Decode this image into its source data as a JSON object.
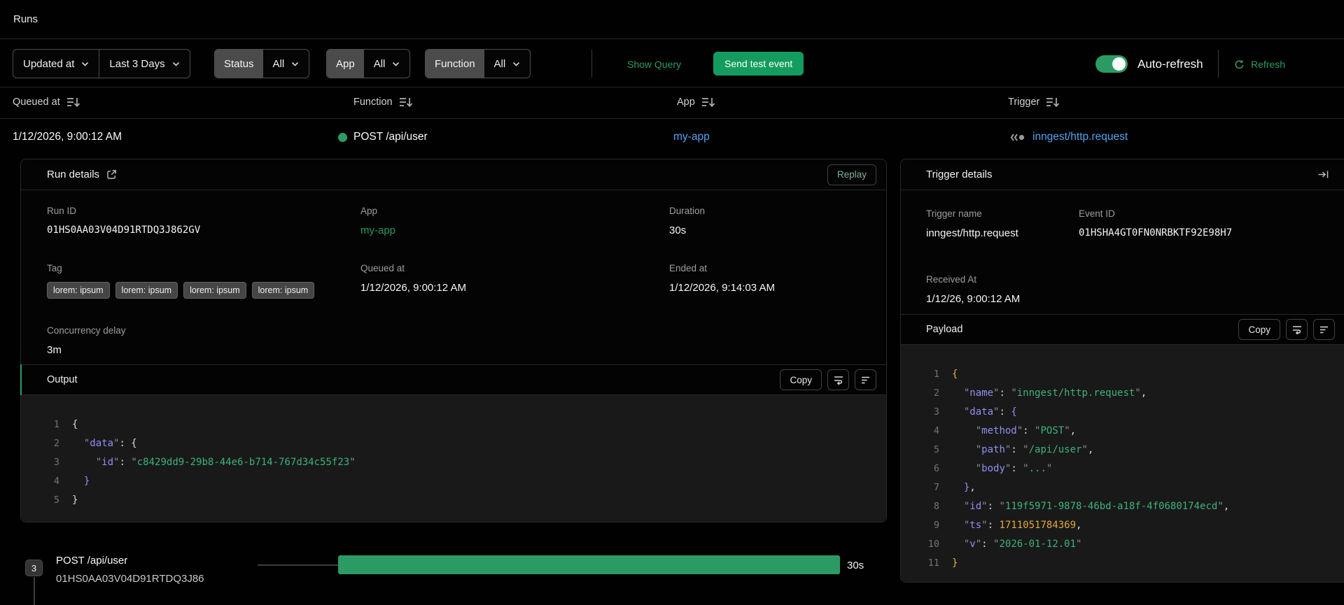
{
  "page": {
    "title": "Runs"
  },
  "filters": {
    "sort_field": "Updated at",
    "time_range": "Last 3 Days",
    "status": {
      "label": "Status",
      "value": "All"
    },
    "app": {
      "label": "App",
      "value": "All"
    },
    "function": {
      "label": "Function",
      "value": "All"
    },
    "show_query": "Show Query",
    "send_test_event": "Send test event",
    "auto_refresh_label": "Auto-refresh",
    "auto_refresh_on": true,
    "refresh_label": "Refresh"
  },
  "table": {
    "columns": {
      "queued_at": "Queued at",
      "function": "Function",
      "app": "App",
      "trigger": "Trigger"
    },
    "row": {
      "queued_at": "1/12/2026, 9:00:12 AM",
      "function": "POST /api/user",
      "status_color": "#2c9b63",
      "app": "my-app",
      "trigger": "inngest/http.request"
    }
  },
  "run_details": {
    "title": "Run details",
    "replay_label": "Replay",
    "run_id": {
      "label": "Run ID",
      "value": "01HS0AA03V04D91RTDQ3J862GV"
    },
    "app": {
      "label": "App",
      "value": "my-app"
    },
    "duration": {
      "label": "Duration",
      "value": "30s"
    },
    "tag": {
      "label": "Tag",
      "chips": [
        "lorem: ipsum",
        "lorem: ipsum",
        "lorem: ipsum",
        "lorem: ipsum"
      ]
    },
    "queued_at": {
      "label": "Queued at",
      "value": "1/12/2026, 9:00:12 AM"
    },
    "ended_at": {
      "label": "Ended at",
      "value": "1/12/2026, 9:14:03 AM"
    },
    "concurrency_delay": {
      "label": "Concurrency delay",
      "value": "3m"
    },
    "output": {
      "title": "Output",
      "copy_label": "Copy",
      "lines": [
        [
          [
            "w",
            "{"
          ]
        ],
        [
          [
            "w",
            "  "
          ],
          [
            "q",
            "\""
          ],
          [
            "v",
            "data"
          ],
          [
            "q",
            "\""
          ],
          [
            "w",
            ": {"
          ]
        ],
        [
          [
            "w",
            "    "
          ],
          [
            "q",
            "\""
          ],
          [
            "v",
            "id"
          ],
          [
            "q",
            "\""
          ],
          [
            "w",
            ": "
          ],
          [
            "q",
            "\""
          ],
          [
            "s",
            "c8429dd9-29b8-44e6-b714-767d34c55f23"
          ],
          [
            "q",
            "\""
          ]
        ],
        [
          [
            "w",
            "  "
          ],
          [
            "v",
            "}"
          ]
        ],
        [
          [
            "w",
            "}"
          ]
        ]
      ]
    }
  },
  "trigger_details": {
    "title": "Trigger details",
    "trigger_name": {
      "label": "Trigger name",
      "value": "inngest/http.request"
    },
    "event_id": {
      "label": "Event ID",
      "value": "01HSHA4GT0FN0NRBKTF92E98H7"
    },
    "received_at": {
      "label": "Received At",
      "value": "1/12/26, 9:00:12 AM"
    },
    "payload": {
      "title": "Payload",
      "copy_label": "Copy",
      "lines": [
        [
          [
            "y",
            "{"
          ]
        ],
        [
          [
            "w",
            "  "
          ],
          [
            "q",
            "\""
          ],
          [
            "v",
            "name"
          ],
          [
            "q",
            "\""
          ],
          [
            "w",
            ": "
          ],
          [
            "q",
            "\""
          ],
          [
            "s",
            "inngest/http.request"
          ],
          [
            "q",
            "\""
          ],
          [
            "w",
            ","
          ]
        ],
        [
          [
            "w",
            "  "
          ],
          [
            "q",
            "\""
          ],
          [
            "v",
            "data"
          ],
          [
            "q",
            "\""
          ],
          [
            "w",
            ": "
          ],
          [
            "v",
            "{"
          ]
        ],
        [
          [
            "w",
            "    "
          ],
          [
            "q",
            "\""
          ],
          [
            "v",
            "method"
          ],
          [
            "q",
            "\""
          ],
          [
            "w",
            ": "
          ],
          [
            "q",
            "\""
          ],
          [
            "s",
            "POST"
          ],
          [
            "q",
            "\""
          ],
          [
            "w",
            ","
          ]
        ],
        [
          [
            "w",
            "    "
          ],
          [
            "q",
            "\""
          ],
          [
            "v",
            "path"
          ],
          [
            "q",
            "\""
          ],
          [
            "w",
            ": "
          ],
          [
            "q",
            "\""
          ],
          [
            "s",
            "/api/user"
          ],
          [
            "q",
            "\""
          ],
          [
            "w",
            ","
          ]
        ],
        [
          [
            "w",
            "    "
          ],
          [
            "q",
            "\""
          ],
          [
            "v",
            "body"
          ],
          [
            "q",
            "\""
          ],
          [
            "w",
            ": "
          ],
          [
            "q",
            "\""
          ],
          [
            "s",
            "..."
          ],
          [
            "q",
            "\""
          ]
        ],
        [
          [
            "w",
            "  "
          ],
          [
            "v",
            "}"
          ],
          [
            "w",
            ","
          ]
        ],
        [
          [
            "w",
            "  "
          ],
          [
            "q",
            "\""
          ],
          [
            "v",
            "id"
          ],
          [
            "q",
            "\""
          ],
          [
            "w",
            ": "
          ],
          [
            "q",
            "\""
          ],
          [
            "s",
            "119f5971-9878-46bd-a18f-4f0680174ecd"
          ],
          [
            "q",
            "\""
          ],
          [
            "w",
            ","
          ]
        ],
        [
          [
            "w",
            "  "
          ],
          [
            "q",
            "\""
          ],
          [
            "v",
            "ts"
          ],
          [
            "q",
            "\""
          ],
          [
            "w",
            ": "
          ],
          [
            "n",
            "1711051784369"
          ],
          [
            "w",
            ","
          ]
        ],
        [
          [
            "w",
            "  "
          ],
          [
            "q",
            "\""
          ],
          [
            "v",
            "v"
          ],
          [
            "q",
            "\""
          ],
          [
            "w",
            ": "
          ],
          [
            "q",
            "\""
          ],
          [
            "s",
            "2026-01-12.01"
          ],
          [
            "q",
            "\""
          ]
        ],
        [
          [
            "y",
            "}"
          ]
        ]
      ]
    }
  },
  "timeline": {
    "step_count": "3",
    "step_name": "POST /api/user",
    "run_id": "01HS0AA03V04D91RTDQ3J86",
    "duration": "30s"
  },
  "colors": {
    "accent_green": "#2c9b63",
    "button_green": "#149c5e",
    "link_blue": "#54a3f0",
    "code_key": "#8f90f5",
    "code_string": "#3cb37a",
    "code_number": "#e3a93c",
    "code_brace_outer": "#e3b341",
    "code_background": "#191919"
  }
}
